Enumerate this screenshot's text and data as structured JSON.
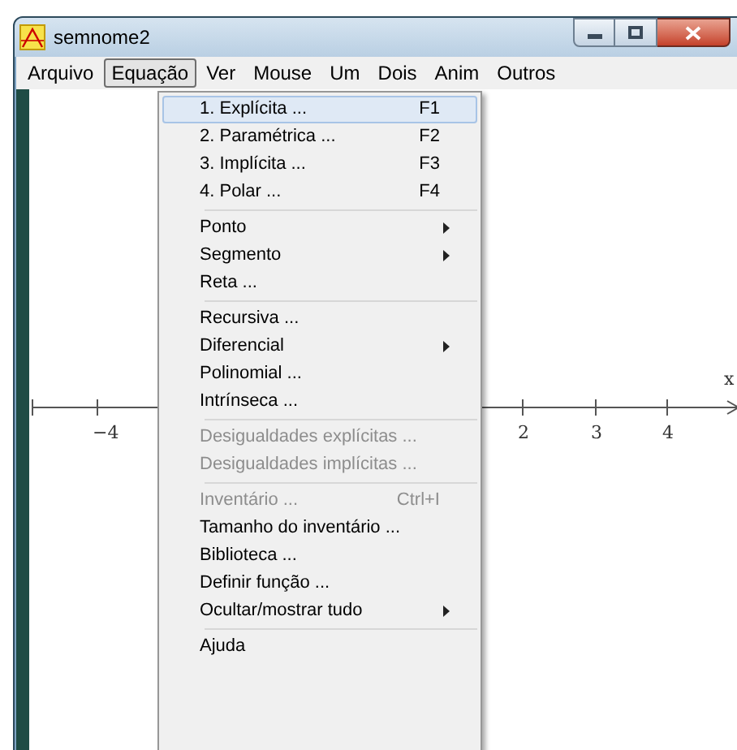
{
  "window": {
    "title": "semnome2"
  },
  "menu_bar": [
    {
      "label": "Arquivo",
      "selected": false
    },
    {
      "label": "Equação",
      "selected": true
    },
    {
      "label": "Ver",
      "selected": false
    },
    {
      "label": "Mouse",
      "selected": false
    },
    {
      "label": "Um",
      "selected": false
    },
    {
      "label": "Dois",
      "selected": false
    },
    {
      "label": "Anim",
      "selected": false
    },
    {
      "label": "Outros",
      "selected": false
    }
  ],
  "axis": {
    "label": "x",
    "tick_labels": [
      {
        "label": "−4"
      },
      {
        "label": "2"
      },
      {
        "label": "3"
      },
      {
        "label": "4"
      }
    ]
  },
  "menu": {
    "sections": [
      [
        {
          "label": "1. Explícita ...",
          "shortcut": "F1",
          "submenu": false,
          "disabled": false,
          "selected": true
        },
        {
          "label": "2. Paramétrica ...",
          "shortcut": "F2",
          "submenu": false,
          "disabled": false,
          "selected": false
        },
        {
          "label": "3. Implícita ...",
          "shortcut": "F3",
          "submenu": false,
          "disabled": false,
          "selected": false
        },
        {
          "label": "4. Polar ...",
          "shortcut": "F4",
          "submenu": false,
          "disabled": false,
          "selected": false
        }
      ],
      [
        {
          "label": "Ponto",
          "submenu": true,
          "disabled": false,
          "selected": false
        },
        {
          "label": "Segmento",
          "submenu": true,
          "disabled": false,
          "selected": false
        },
        {
          "label": "Reta ...",
          "submenu": false,
          "disabled": false,
          "selected": false
        }
      ],
      [
        {
          "label": "Recursiva ...",
          "submenu": false,
          "disabled": false,
          "selected": false
        },
        {
          "label": "Diferencial",
          "submenu": true,
          "disabled": false,
          "selected": false
        },
        {
          "label": "Polinomial ...",
          "submenu": false,
          "disabled": false,
          "selected": false
        },
        {
          "label": "Intrínseca ...",
          "submenu": false,
          "disabled": false,
          "selected": false
        }
      ],
      [
        {
          "label": "Desigualdades explícitas ...",
          "submenu": false,
          "disabled": true,
          "selected": false
        },
        {
          "label": "Desigualdades implícitas ...",
          "submenu": false,
          "disabled": true,
          "selected": false
        }
      ],
      [
        {
          "label": "Inventário ...",
          "shortcut": "Ctrl+I",
          "submenu": false,
          "disabled": true,
          "selected": false
        },
        {
          "label": "Tamanho do inventário ...",
          "submenu": false,
          "disabled": false,
          "selected": false
        },
        {
          "label": "Biblioteca ...",
          "submenu": false,
          "disabled": false,
          "selected": false
        },
        {
          "label": "Definir função ...",
          "submenu": false,
          "disabled": false,
          "selected": false
        },
        {
          "label": "Ocultar/mostrar tudo",
          "submenu": true,
          "disabled": false,
          "selected": false
        }
      ],
      [
        {
          "label": "Ajuda",
          "submenu": false,
          "disabled": false,
          "selected": false
        }
      ]
    ]
  }
}
